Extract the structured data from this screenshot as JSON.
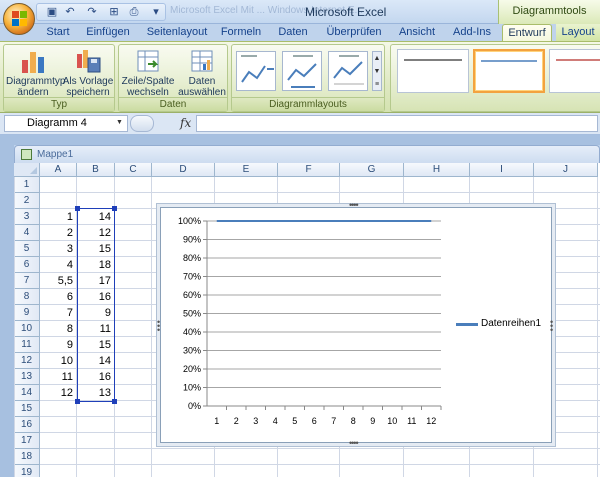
{
  "window": {
    "title": "Microsoft Excel",
    "background_title": "Microsoft Excel Mit ... Windows Internet E...",
    "context_group": "Diagrammtools"
  },
  "tabs": [
    {
      "label": "Start",
      "active": false
    },
    {
      "label": "Einfügen",
      "active": false
    },
    {
      "label": "Seitenlayout",
      "active": false
    },
    {
      "label": "Formeln",
      "active": false
    },
    {
      "label": "Daten",
      "active": false
    },
    {
      "label": "Überprüfen",
      "active": false
    },
    {
      "label": "Ansicht",
      "active": false
    },
    {
      "label": "Add-Ins",
      "active": false
    },
    {
      "label": "Entwurf",
      "active": true
    },
    {
      "label": "Layout",
      "active": false
    }
  ],
  "ribbon": {
    "typ_group": {
      "label": "Typ",
      "change_type": "Diagrammtyp\nändern",
      "save_template": "Als Vorlage\nspeichern"
    },
    "daten_group": {
      "label": "Daten",
      "switch_row_col": "Zeile/Spalte\nwechseln",
      "select_data": "Daten\nauswählen"
    },
    "layouts_group": {
      "label": "Diagrammlayouts"
    }
  },
  "formula_bar": {
    "name_box": "Diagramm 4",
    "fx_label": "fx",
    "formula": ""
  },
  "workbook": {
    "name": "Mappe1"
  },
  "sheet": {
    "columns": [
      "A",
      "B",
      "C",
      "D",
      "E",
      "F",
      "G",
      "H",
      "I",
      "J"
    ],
    "rows": [
      "1",
      "2",
      "3",
      "4",
      "5",
      "6",
      "7",
      "8",
      "9",
      "10",
      "11",
      "12",
      "13",
      "14",
      "15",
      "16",
      "17",
      "18",
      "19"
    ],
    "col_a": [
      "1",
      "2",
      "3",
      "4",
      "5,5",
      "6",
      "7",
      "8",
      "9",
      "10",
      "11",
      "12"
    ],
    "col_b": [
      "14",
      "12",
      "15",
      "18",
      "17",
      "16",
      "9",
      "11",
      "15",
      "14",
      "16",
      "13"
    ]
  },
  "chart_data": {
    "type": "line",
    "x": [
      1,
      2,
      3,
      4,
      5,
      6,
      7,
      8,
      9,
      10,
      11,
      12
    ],
    "categories": [
      "1",
      "2",
      "3",
      "4",
      "5",
      "6",
      "7",
      "8",
      "9",
      "10",
      "11",
      "12"
    ],
    "series": [
      {
        "name": "Datenreihen1",
        "values": [
          1,
          1,
          1,
          1,
          1,
          1,
          1,
          1,
          1,
          1,
          1,
          1
        ],
        "color": "#4a7ebb"
      }
    ],
    "y_ticks": [
      "0%",
      "10%",
      "20%",
      "30%",
      "40%",
      "50%",
      "60%",
      "70%",
      "80%",
      "90%",
      "100%"
    ],
    "ylim": [
      0,
      1
    ],
    "grid": true,
    "legend": "right"
  },
  "colors": {
    "series": "#4a7ebb",
    "selection": "#1f3fb9",
    "ribbon_context": "#dfe9c3"
  }
}
